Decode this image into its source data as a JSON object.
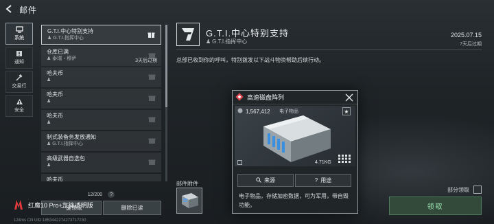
{
  "window": {
    "title": "邮件"
  },
  "nav": [
    {
      "label": "系统",
      "icon": "system-icon",
      "active": true
    },
    {
      "label": "通知",
      "icon": "notice-icon",
      "active": false
    },
    {
      "label": "交易行",
      "icon": "hammer-icon",
      "active": false
    },
    {
      "label": "安全",
      "icon": "warning-icon",
      "active": false
    }
  ],
  "mails": [
    {
      "subject": "G.T.I.中心特别支持",
      "sender": "G.T.I.指挥中心",
      "expiry": "",
      "active": true,
      "gift": true
    },
    {
      "subject": "仓库已满",
      "sender": "泰瑞・穆萨",
      "expiry": "3天后过期",
      "active": false,
      "gift": true
    },
    {
      "subject": "哈夫币",
      "sender": "",
      "expiry": "",
      "active": false,
      "gift": true
    },
    {
      "subject": "哈夫币",
      "sender": "",
      "expiry": "",
      "active": false,
      "gift": true
    },
    {
      "subject": "哈夫币",
      "sender": "",
      "expiry": "",
      "active": false,
      "gift": true
    },
    {
      "subject": "制式装备务发放通知",
      "sender": "G.T.I.指挥中心",
      "expiry": "",
      "active": false,
      "gift": true
    },
    {
      "subject": "高级武器自选包",
      "sender": "",
      "expiry": "",
      "active": false,
      "gift": true
    },
    {
      "subject": "哈夫币",
      "sender": "",
      "expiry": "",
      "active": false,
      "gift": true
    }
  ],
  "mail_count": "12/200",
  "count_help": "?",
  "buttons": {
    "claim_all": "一键领取",
    "delete_read": "删除已读",
    "claim": "领取"
  },
  "watermark": "红魔10 Pro+氘锋透明版",
  "status_bar": "124ms  CN UID:1853442274273717230",
  "detail": {
    "title": "G.T.I.中心特别支持",
    "sender": "G.T.I.指挥中心",
    "date": "2025.07.15",
    "expire": "7天后过期",
    "body": "总部已收到你的呼叫，特别拨发以下战斗物资帮助后续行动。",
    "attachments_label": "邮件附件",
    "partial_claim": "部分领取"
  },
  "popup": {
    "title": "高速磁盘阵列",
    "price": "1,567,412",
    "category": "电子物品",
    "weight": "4.71KG",
    "source_label": "来源",
    "usage_label": "用途",
    "description": "电子物品，存储加密数据，可为军用，带自毁功能。"
  },
  "colors": {
    "accent_green": "#9be7b4",
    "rarity_red": "#e0464f",
    "panel": "#202528"
  }
}
